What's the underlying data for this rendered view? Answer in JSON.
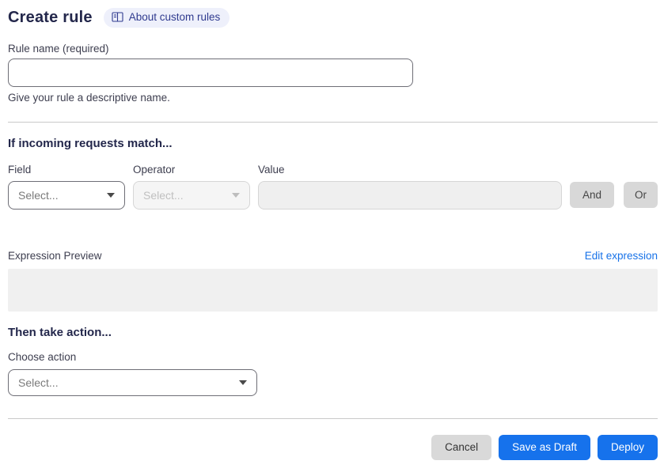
{
  "page": {
    "title": "Create rule",
    "about_badge_label": "About custom rules"
  },
  "rule_name": {
    "label": "Rule name (required)",
    "value": "",
    "helper": "Give your rule a descriptive name."
  },
  "match_section": {
    "heading": "If incoming requests match...",
    "field": {
      "label": "Field",
      "selected": "Select...",
      "enabled": true
    },
    "operator": {
      "label": "Operator",
      "selected": "Select...",
      "enabled": false
    },
    "value": {
      "label": "Value",
      "value": "",
      "enabled": false
    },
    "and_button_label": "And",
    "or_button_label": "Or",
    "expression_preview_label": "Expression Preview",
    "edit_expression_link": "Edit expression",
    "expression_value": ""
  },
  "action_section": {
    "heading": "Then take action...",
    "choose_label": "Choose action",
    "selected": "Select..."
  },
  "footer": {
    "cancel_label": "Cancel",
    "save_draft_label": "Save as Draft",
    "deploy_label": "Deploy"
  },
  "colors": {
    "primary_blue": "#1672ec",
    "link_blue": "#1772e8",
    "badge_bg": "#eef0fb",
    "badge_text": "#2f3a8f",
    "divider": "#c9c9c9",
    "disabled_bg": "#f5f5f5",
    "preview_box_bg": "#f0f0f0"
  }
}
